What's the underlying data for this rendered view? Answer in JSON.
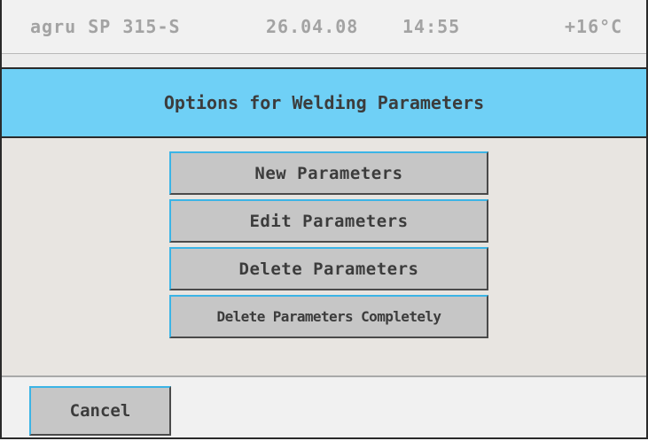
{
  "status": {
    "device": "agru SP 315-S",
    "date": "26.04.08",
    "time": "14:55",
    "temperature": "+16°C"
  },
  "title": "Options for Welding Parameters",
  "menu": {
    "items": [
      {
        "label": "New Parameters"
      },
      {
        "label": "Edit Parameters"
      },
      {
        "label": "Delete Parameters"
      },
      {
        "label": "Delete Parameters Completely"
      }
    ]
  },
  "footer": {
    "cancel_label": "Cancel"
  },
  "colors": {
    "title_bar": "#6fd0f6",
    "button_face": "#c6c6c6",
    "button_highlight": "#3bb4e6",
    "panel_background": "#e8e5e1",
    "status_text": "#a3a3a3"
  }
}
